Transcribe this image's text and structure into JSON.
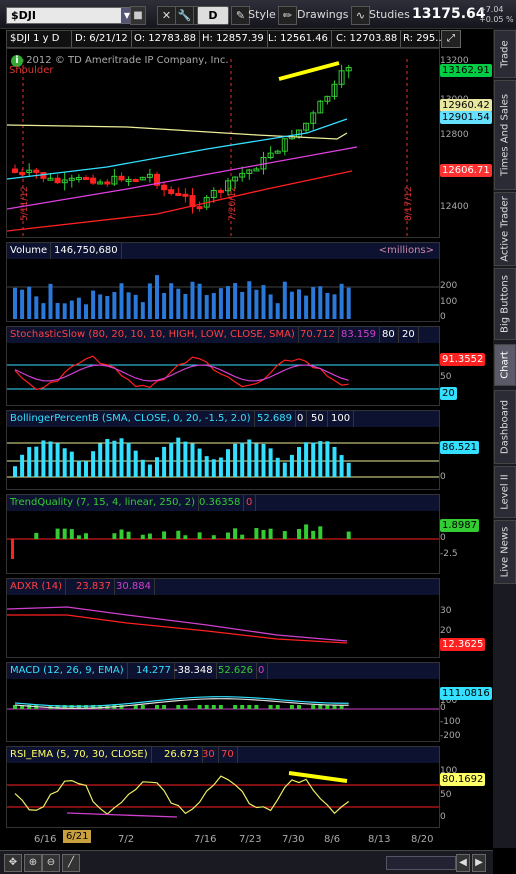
{
  "toolbar": {
    "symbol": "$DJI",
    "aggregation": "D",
    "style_label": "Style",
    "drawings_label": "Drawings",
    "studies_label": "Studies",
    "last_price": "13175.64",
    "change_abs": "+7.04",
    "change_pct": "+0.05 %"
  },
  "infobar": {
    "period": "$DJI 1 y D",
    "date": "D: 6/21/12",
    "open": "O: 12783.88",
    "high": "H: 12857.39",
    "low": "L: 12561.46",
    "close": "C: 12703.88",
    "range": "R: 295...."
  },
  "price_panel": {
    "copyright": "2012 © TD Ameritrade IP Company, Inc.",
    "pattern_label": "Shoulder",
    "marker_dates": [
      "5/11/12",
      "7/20/12",
      "8/17/12"
    ],
    "ticks": [
      "13200",
      "13000",
      "12800",
      "12600",
      "12400"
    ],
    "tags": [
      {
        "text": "13162.91",
        "color": "#00cc44"
      },
      {
        "text": "12960.42",
        "color": "#e8e8a0"
      },
      {
        "text": "12901.54",
        "color": "#66e0ff"
      },
      {
        "text": "12606.71",
        "color": "#ff3030"
      }
    ]
  },
  "volume_panel": {
    "name": "Volume",
    "value": "146,750,680",
    "units": "<millions>",
    "ticks": [
      "200",
      "100",
      "0"
    ]
  },
  "stoch_panel": {
    "name": "StochasticSlow (80, 20, 10, 10, HIGH, LOW, CLOSE, SMA)",
    "v1": "70.712",
    "v2": "83.159",
    "v3": "80",
    "v4": "20",
    "ticks": [
      "50"
    ],
    "tag1": "91.3552",
    "tag2": "20"
  },
  "bollinger_panel": {
    "name": "BollingerPercentB (SMA, CLOSE, 0, 20, -1.5, 2.0)",
    "v1": "52.689",
    "v2": "0",
    "v3": "50",
    "v4": "100",
    "ticks": [
      "0"
    ],
    "tag1": "86.521"
  },
  "trend_panel": {
    "name": "TrendQuality (7, 15, 4, linear, 250, 2)",
    "v1": "0.36358",
    "v2": "0",
    "ticks": [
      "0",
      "-2.5"
    ],
    "tag1": "1.8987"
  },
  "adxr_panel": {
    "name": "ADXR (14)",
    "v1": "23.837",
    "v2": "30.884",
    "ticks": [
      "30",
      "20"
    ],
    "tag1": "12.3625"
  },
  "macd_panel": {
    "name": "MACD (12, 26, 9, EMA)",
    "v1": "14.277",
    "v2": "-38.348",
    "v3": "52.626",
    "v4": "0",
    "ticks": [
      "100",
      "0",
      "-100",
      "-200"
    ],
    "tag1": "111.0816"
  },
  "rsi_panel": {
    "name": "RSI_EMA (5, 70, 30, CLOSE)",
    "v1": "26.673",
    "v2": "30",
    "v3": "70",
    "ticks": [
      "100",
      "50",
      "0"
    ],
    "tag1": "80.1692"
  },
  "dates": [
    "6/16",
    "6/21",
    "7/2",
    "7/16",
    "7/23",
    "7/30",
    "8/6",
    "8/13",
    "8/20"
  ],
  "right_tabs": [
    "Trade",
    "Times And Sales",
    "Active Trader",
    "Big Buttons",
    "Chart",
    "Dashboard",
    "Level II",
    "Live News"
  ],
  "colors": {
    "up": "#33cc33",
    "down": "#ff2020",
    "accent_yellow": "#ffff00",
    "cyan": "#33e0ff"
  }
}
